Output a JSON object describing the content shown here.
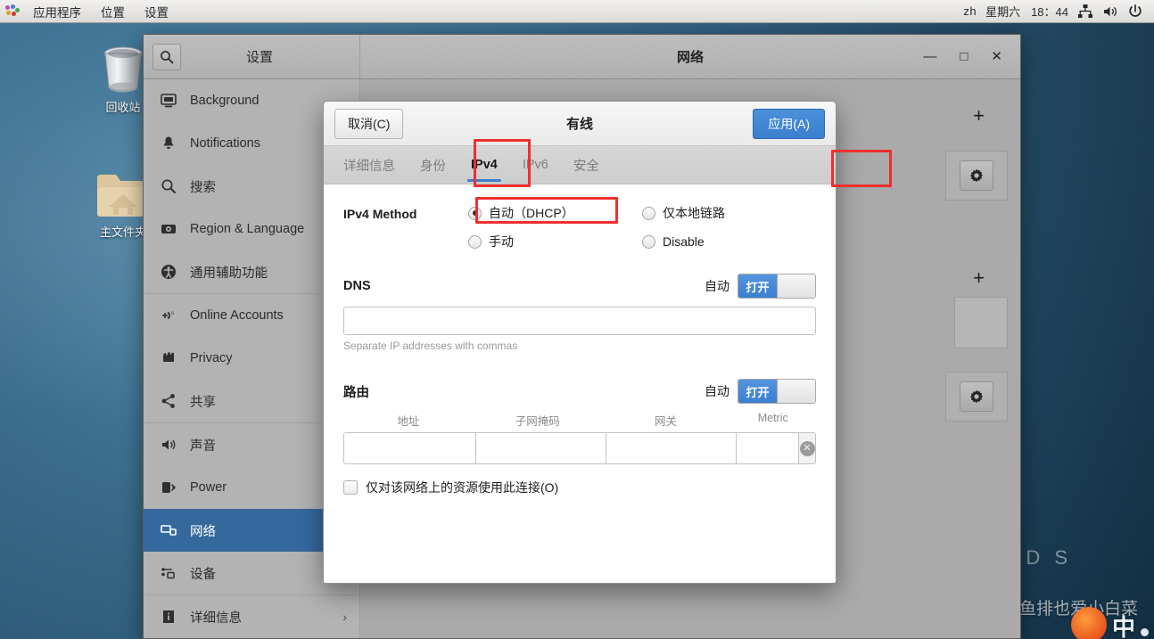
{
  "topbar": {
    "menus": [
      "应用程序",
      "位置",
      "设置"
    ],
    "language": "zh",
    "day": "星期六",
    "time": "18：44",
    "icons": [
      "network-icon",
      "volume-icon",
      "power-icon"
    ]
  },
  "desktop": {
    "icons": [
      {
        "name": "trash-icon",
        "label": "回收站"
      },
      {
        "name": "home-folder-icon",
        "label": "主文件夹"
      }
    ],
    "background_text": "D S",
    "watermark": "CSDN @鱼排也爱小白菜",
    "ime": {
      "glyph": "中"
    }
  },
  "settings_window": {
    "sidebar_title": "设置",
    "search_icon": "search-icon",
    "panel_title": "网络",
    "window_buttons": {
      "minimize": "—",
      "maximize": "□",
      "close": "✕"
    },
    "sidebar_items": [
      {
        "label": "Background",
        "icon": "wallpaper-icon",
        "selected": false,
        "chevron": false
      },
      {
        "label": "Notifications",
        "icon": "bell-icon",
        "selected": false,
        "chevron": false
      },
      {
        "label": "搜索",
        "icon": "search-icon",
        "selected": false,
        "chevron": false
      },
      {
        "label": "Region & Language",
        "icon": "region-icon",
        "selected": false,
        "chevron": false
      },
      {
        "label": "通用辅助功能",
        "icon": "accessibility-icon",
        "selected": false,
        "chevron": false
      },
      {
        "label": "Online Accounts",
        "icon": "online-accounts-icon",
        "selected": false,
        "chevron": false
      },
      {
        "label": "Privacy",
        "icon": "privacy-icon",
        "selected": false,
        "chevron": false
      },
      {
        "label": "共享",
        "icon": "sharing-icon",
        "selected": false,
        "chevron": false
      },
      {
        "label": "声音",
        "icon": "sound-icon",
        "selected": false,
        "chevron": false
      },
      {
        "label": "Power",
        "icon": "power-battery-icon",
        "selected": false,
        "chevron": false
      },
      {
        "label": "网络",
        "icon": "network-icon",
        "selected": true,
        "chevron": false
      },
      {
        "label": "设备",
        "icon": "devices-icon",
        "selected": false,
        "chevron": true
      },
      {
        "label": "详细信息",
        "icon": "info-icon",
        "selected": false,
        "chevron": true
      }
    ],
    "content_buttons": {
      "add_label": "+",
      "gear_label": "gear-icon"
    }
  },
  "dialog": {
    "title": "有线",
    "cancel_label": "取消(C)",
    "apply_label": "应用(A)",
    "tabs": [
      {
        "label": "详细信息",
        "active": false
      },
      {
        "label": "身份",
        "active": false
      },
      {
        "label": "IPv4",
        "active": true
      },
      {
        "label": "IPv6",
        "active": false
      },
      {
        "label": "安全",
        "active": false
      }
    ],
    "ipv4_method": {
      "label": "IPv4 Method",
      "options": [
        {
          "label": "自动（DHCP）",
          "checked": true
        },
        {
          "label": "仅本地链路",
          "checked": false
        },
        {
          "label": "手动",
          "checked": false
        },
        {
          "label": "Disable",
          "checked": false
        }
      ]
    },
    "dns": {
      "title": "DNS",
      "auto_label": "自动",
      "switch_state": "打开",
      "value": "",
      "hint": "Separate IP addresses with commas"
    },
    "routes": {
      "title": "路由",
      "auto_label": "自动",
      "switch_state": "打开",
      "columns": [
        "地址",
        "子网掩码",
        "网关",
        "Metric"
      ],
      "rows": [
        {
          "address": "",
          "netmask": "",
          "gateway": "",
          "metric": ""
        }
      ],
      "clear_icon": "clear-row-icon"
    },
    "restrict_checkbox": {
      "label": "仅对该网络上的资源使用此连接(O)",
      "checked": false
    }
  },
  "annotations": {
    "accent_color": "#ef2f2f",
    "boxes": [
      "ipv4-tab",
      "dhcp-radio",
      "settings-gear"
    ]
  }
}
